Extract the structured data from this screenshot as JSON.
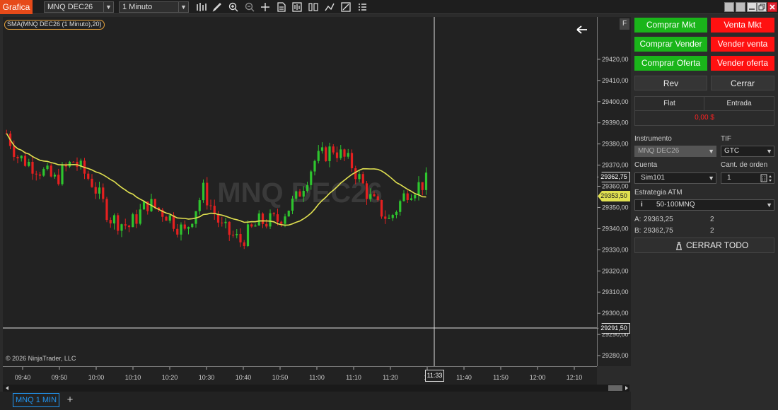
{
  "app_title": "Grafica",
  "toolbar": {
    "instrument": "MNQ DEC26",
    "interval": "1 Minuto"
  },
  "chart": {
    "indicator_label": "SMA(MNQ DEC26 (1 Minuto),20)",
    "watermark": "MNQ DEC26",
    "copyright": "© 2026 NinjaTrader, LLC",
    "f_label": "F",
    "price_ticks": [
      "29420,00",
      "29410,00",
      "29400,00",
      "29390,00",
      "29380,00",
      "29370,00",
      "29360,00",
      "29350,00",
      "29340,00",
      "29330,00",
      "29320,00",
      "29310,00",
      "29300,00",
      "29290,00",
      "29280,00"
    ],
    "time_ticks": [
      "09:40",
      "09:50",
      "10:00",
      "10:10",
      "10:20",
      "10:30",
      "10:40",
      "10:50",
      "11:00",
      "11:10",
      "11:20",
      "11",
      "11:40",
      "11:50",
      "12:00",
      "12:10"
    ],
    "crosshair_time": "11:33",
    "crosshair_price": "29291,50",
    "current_price": "29353,50",
    "ask_price_marker": "29362,75",
    "colors": {
      "up": "#2ec52e",
      "down": "#e52020",
      "sma": "#e0e050",
      "background": "#222222"
    }
  },
  "chart_data": {
    "type": "candlestick",
    "y_unit": "price",
    "ylim": [
      29275,
      29440
    ],
    "x_range": [
      "09:36",
      "12:16"
    ],
    "sma_period": 20,
    "approx_candles": [
      {
        "t": "09:37",
        "o": 29387,
        "h": 29389,
        "l": 29382,
        "c": 29385
      },
      {
        "t": "09:40",
        "o": 29381,
        "h": 29384,
        "l": 29372,
        "c": 29374
      },
      {
        "t": "09:45",
        "o": 29371,
        "h": 29377,
        "l": 29366,
        "c": 29369
      },
      {
        "t": "09:50",
        "o": 29368,
        "h": 29374,
        "l": 29360,
        "c": 29363
      },
      {
        "t": "09:55",
        "o": 29370,
        "h": 29376,
        "l": 29364,
        "c": 29372
      },
      {
        "t": "10:00",
        "o": 29372,
        "h": 29378,
        "l": 29360,
        "c": 29362
      },
      {
        "t": "10:05",
        "o": 29360,
        "h": 29364,
        "l": 29340,
        "c": 29345
      },
      {
        "t": "10:10",
        "o": 29345,
        "h": 29352,
        "l": 29338,
        "c": 29341
      },
      {
        "t": "10:15",
        "o": 29340,
        "h": 29356,
        "l": 29338,
        "c": 29352
      },
      {
        "t": "10:20",
        "o": 29352,
        "h": 29366,
        "l": 29344,
        "c": 29347
      },
      {
        "t": "10:25",
        "o": 29346,
        "h": 29350,
        "l": 29334,
        "c": 29338
      },
      {
        "t": "10:30",
        "o": 29338,
        "h": 29362,
        "l": 29336,
        "c": 29358
      },
      {
        "t": "10:35",
        "o": 29356,
        "h": 29358,
        "l": 29338,
        "c": 29340
      },
      {
        "t": "10:40",
        "o": 29340,
        "h": 29344,
        "l": 29328,
        "c": 29334
      },
      {
        "t": "10:45",
        "o": 29334,
        "h": 29348,
        "l": 29330,
        "c": 29343
      },
      {
        "t": "10:50",
        "o": 29343,
        "h": 29352,
        "l": 29340,
        "c": 29344
      },
      {
        "t": "10:55",
        "o": 29344,
        "h": 29356,
        "l": 29340,
        "c": 29354
      },
      {
        "t": "11:00",
        "o": 29356,
        "h": 29378,
        "l": 29352,
        "c": 29372
      },
      {
        "t": "11:05",
        "o": 29372,
        "h": 29381,
        "l": 29368,
        "c": 29378
      },
      {
        "t": "11:10",
        "o": 29378,
        "h": 29380,
        "l": 29366,
        "c": 29370
      },
      {
        "t": "11:15",
        "o": 29368,
        "h": 29372,
        "l": 29350,
        "c": 29354
      },
      {
        "t": "11:20",
        "o": 29352,
        "h": 29356,
        "l": 29338,
        "c": 29344
      },
      {
        "t": "11:25",
        "o": 29345,
        "h": 29362,
        "l": 29342,
        "c": 29358
      },
      {
        "t": "11:30",
        "o": 29358,
        "h": 29366,
        "l": 29352,
        "c": 29362
      }
    ]
  },
  "panel": {
    "buttons": {
      "buy_mkt": "Comprar Mkt",
      "sell_mkt": "Venta Mkt",
      "buy_ask": "Comprar Vender",
      "sell_ask": "Vender venta",
      "buy_bid": "Comprar Oferta",
      "sell_bid": "Vender oferta",
      "rev": "Rev",
      "close": "Cerrar"
    },
    "position": {
      "state": "Flat",
      "entry_label": "Entrada",
      "pnl": "0,00 $"
    },
    "instrument_label": "Instrumento",
    "instrument_value": "MNQ DEC26",
    "tif_label": "TIF",
    "tif_value": "GTC",
    "account_label": "Cuenta",
    "account_value": "Sim101",
    "qty_label": "Cant. de orden",
    "qty_value": "1",
    "atm_label": "Estrategia ATM",
    "atm_value": "50-100MNQ",
    "ask_prefix": "A:",
    "ask_price": "29363,25",
    "ask_size": "2",
    "bid_prefix": "B:",
    "bid_price": "29362,75",
    "bid_size": "2",
    "close_all": "CERRAR TODO"
  },
  "tab": {
    "label": "MNQ 1 MIN"
  }
}
